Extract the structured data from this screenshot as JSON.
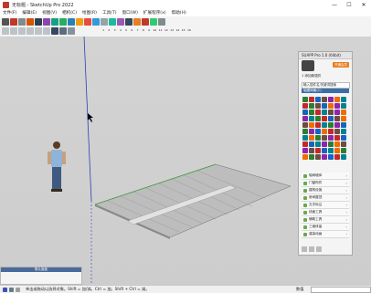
{
  "window": {
    "title": "无标题 - SketchUp Pro 2022",
    "min_glyph": "—",
    "max_glyph": "☐",
    "close_glyph": "✕"
  },
  "menu": [
    "文件(F)",
    "编辑(E)",
    "视图(V)",
    "相机(C)",
    "绘图(R)",
    "工具(T)",
    "窗口(W)",
    "扩展程序(x)",
    "帮助(H)"
  ],
  "scale": [
    "1",
    "2",
    "3",
    "4",
    "5",
    "6",
    "7",
    "8",
    "9",
    "10",
    "11",
    "12",
    "13",
    "14",
    "15",
    "16"
  ],
  "tray": {
    "header": "SUAPP Pro 1.0 (64bit)",
    "promo": "开通会员",
    "user_line": "1 添加新插件",
    "search_placeholder": "输入插件名/关键词搜索",
    "tab_label": "轴图网格(C)",
    "sections": [
      "轴网墙体",
      "门窗构件",
      "建筑设施",
      "房间屋顶",
      "文字标注",
      "线面工具",
      "辅助工具",
      "三维体量",
      "渲染动画"
    ],
    "icon_colors": [
      "#2e7d32",
      "#c62828",
      "#1565c0",
      "#6d4c41",
      "#8e24aa",
      "#ef6c00",
      "#00838f"
    ]
  },
  "instructor": {
    "header": "默认面板"
  },
  "status": {
    "text": "单击或拖动以选择对象。Shift = 加/减。Ctrl = 加。Shift + Ctrl = 减。",
    "measure_label": "数值"
  }
}
